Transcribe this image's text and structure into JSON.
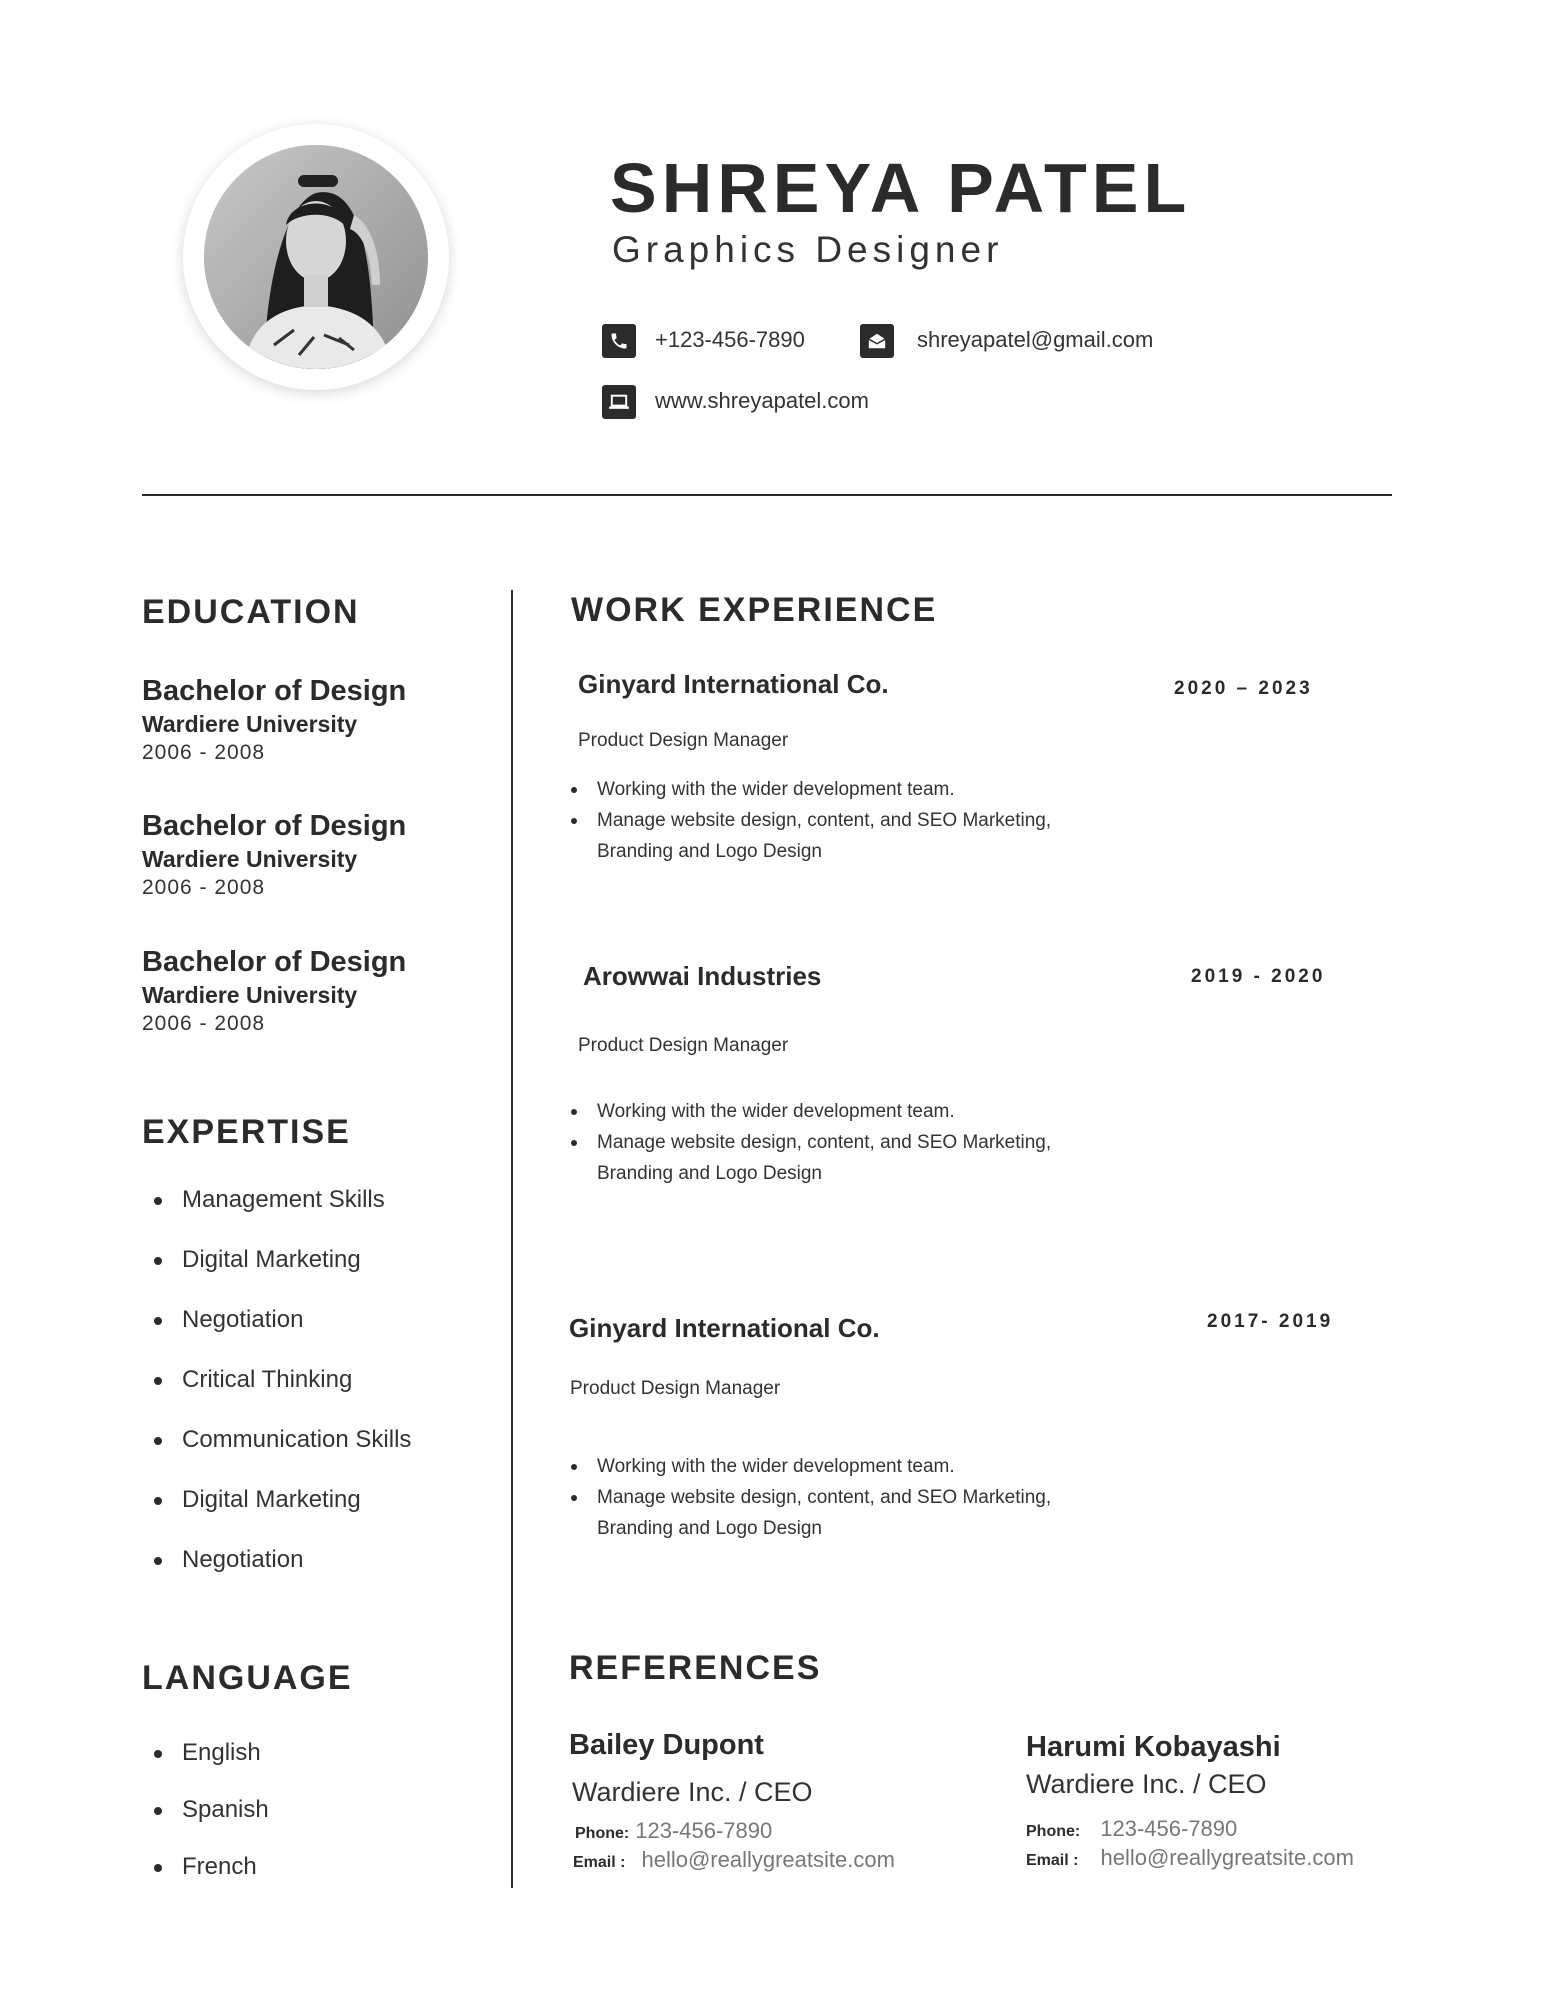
{
  "header": {
    "name": "SHREYA PATEL",
    "title": "Graphics Designer",
    "contact": {
      "phone": "+123-456-7890",
      "email": "shreyapatel@gmail.com",
      "website": "www.shreyapatel.com"
    },
    "icons": {
      "phone": "phone-icon",
      "email": "envelope-icon",
      "website": "laptop-icon"
    }
  },
  "education": {
    "heading": "EDUCATION",
    "items": [
      {
        "degree": "Bachelor of Design",
        "school": "Wardiere University",
        "years": "2006 - 2008"
      },
      {
        "degree": "Bachelor of Design",
        "school": "Wardiere University",
        "years": "2006 - 2008"
      },
      {
        "degree": "Bachelor of Design",
        "school": "Wardiere University",
        "years": "2006 - 2008"
      }
    ]
  },
  "expertise": {
    "heading": "EXPERTISE",
    "items": [
      "Management Skills",
      "Digital Marketing",
      "Negotiation",
      "Critical Thinking",
      "Communication Skills",
      "Digital Marketing",
      "Negotiation"
    ]
  },
  "language": {
    "heading": "LANGUAGE",
    "items": [
      "English",
      "Spanish",
      "French"
    ]
  },
  "work": {
    "heading": "WORK EXPERIENCE",
    "jobs": [
      {
        "company": "Ginyard International Co.",
        "years": "2020 – 2023",
        "role": "Product Design Manager",
        "bullets": [
          "Working with the wider development team.",
          "Manage website design, content, and SEO Marketing, Branding and Logo Design"
        ]
      },
      {
        "company": "Arowwai Industries",
        "years": "2019 - 2020",
        "role": "Product Design Manager",
        "bullets": [
          "Working with the wider development team.",
          "Manage website design, content, and SEO Marketing, Branding and Logo Design"
        ]
      },
      {
        "company": "Ginyard International Co.",
        "years": "2017- 2019",
        "role": "Product Design Manager",
        "bullets": [
          "Working with the wider development team.",
          "Manage website design, content, and SEO Marketing, Branding and Logo Design"
        ]
      }
    ]
  },
  "references": {
    "heading": "REFERENCES",
    "phone_label": "Phone:",
    "email_label": "Email :",
    "people": [
      {
        "name": "Bailey Dupont",
        "company": "Wardiere Inc. / CEO",
        "phone": "123-456-7890",
        "email": "hello@reallygreatsite.com"
      },
      {
        "name": "Harumi Kobayashi",
        "company": "Wardiere Inc. / CEO",
        "phone": "123-456-7890",
        "email": "hello@reallygreatsite.com"
      }
    ]
  }
}
